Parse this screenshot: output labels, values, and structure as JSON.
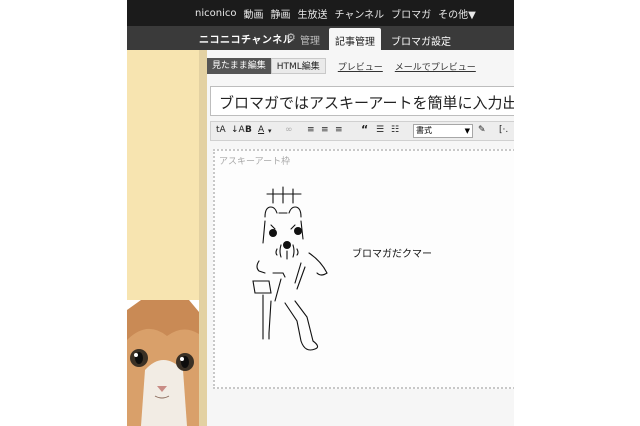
{
  "topnav": [
    "niconico",
    "動画",
    "静画",
    "生放送",
    "チャンネル",
    "ブロマガ",
    "その他▼"
  ],
  "channel_bar": {
    "logo": "ニコニコチャンネル",
    "admin": "管理",
    "tabs": [
      "記事管理",
      "ブロマガ設定"
    ]
  },
  "editor": {
    "modes": [
      "見たまま編集",
      "HTML編集"
    ],
    "links": [
      "プレビュー",
      "メールでプレビュー"
    ],
    "title_value": "ブロマガではアスキーアートを簡単に入力出来る",
    "toolbar": {
      "format_select": "書式",
      "quote": "“"
    },
    "aa_block": {
      "label": "アスキーアート枠",
      "caption": "ブロマガだクマー"
    }
  }
}
